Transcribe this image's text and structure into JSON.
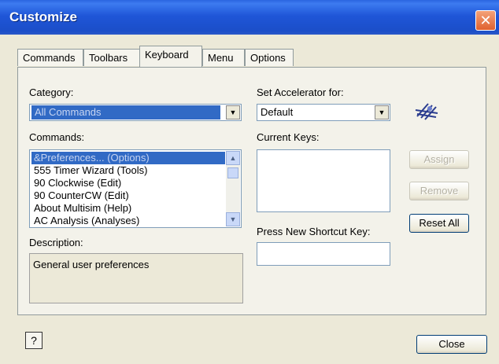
{
  "window": {
    "title": "Customize",
    "close_glyph": "✕"
  },
  "tabs": [
    "Commands",
    "Toolbars",
    "Keyboard",
    "Menu",
    "Options"
  ],
  "active_tab": "Keyboard",
  "category": {
    "label": "Category:",
    "value": "All Commands"
  },
  "commands": {
    "label": "Commands:",
    "items": [
      "&Preferences... (Options)",
      "555 Timer Wizard (Tools)",
      "90 Clockwise (Edit)",
      "90 CounterCW (Edit)",
      "About Multisim (Help)",
      "AC Analysis (Analyses)"
    ],
    "selected_index": 0
  },
  "description": {
    "label": "Description:",
    "text": "General user preferences"
  },
  "accelerator": {
    "label": "Set Accelerator for:",
    "value": "Default"
  },
  "current_keys": {
    "label": "Current Keys:"
  },
  "shortcut": {
    "label": "Press New Shortcut Key:",
    "value": ""
  },
  "buttons": {
    "assign": "Assign",
    "remove": "Remove",
    "reset_all": "Reset All",
    "close": "Close",
    "help": "?"
  },
  "icons": {
    "logo": "multisim-keyboard-icon",
    "help": "help-icon",
    "dropdown": "chevron-down-icon"
  },
  "colors": {
    "titlebar": "#1f56d8",
    "selection": "#316ac5",
    "close_button": "#e0612f"
  }
}
